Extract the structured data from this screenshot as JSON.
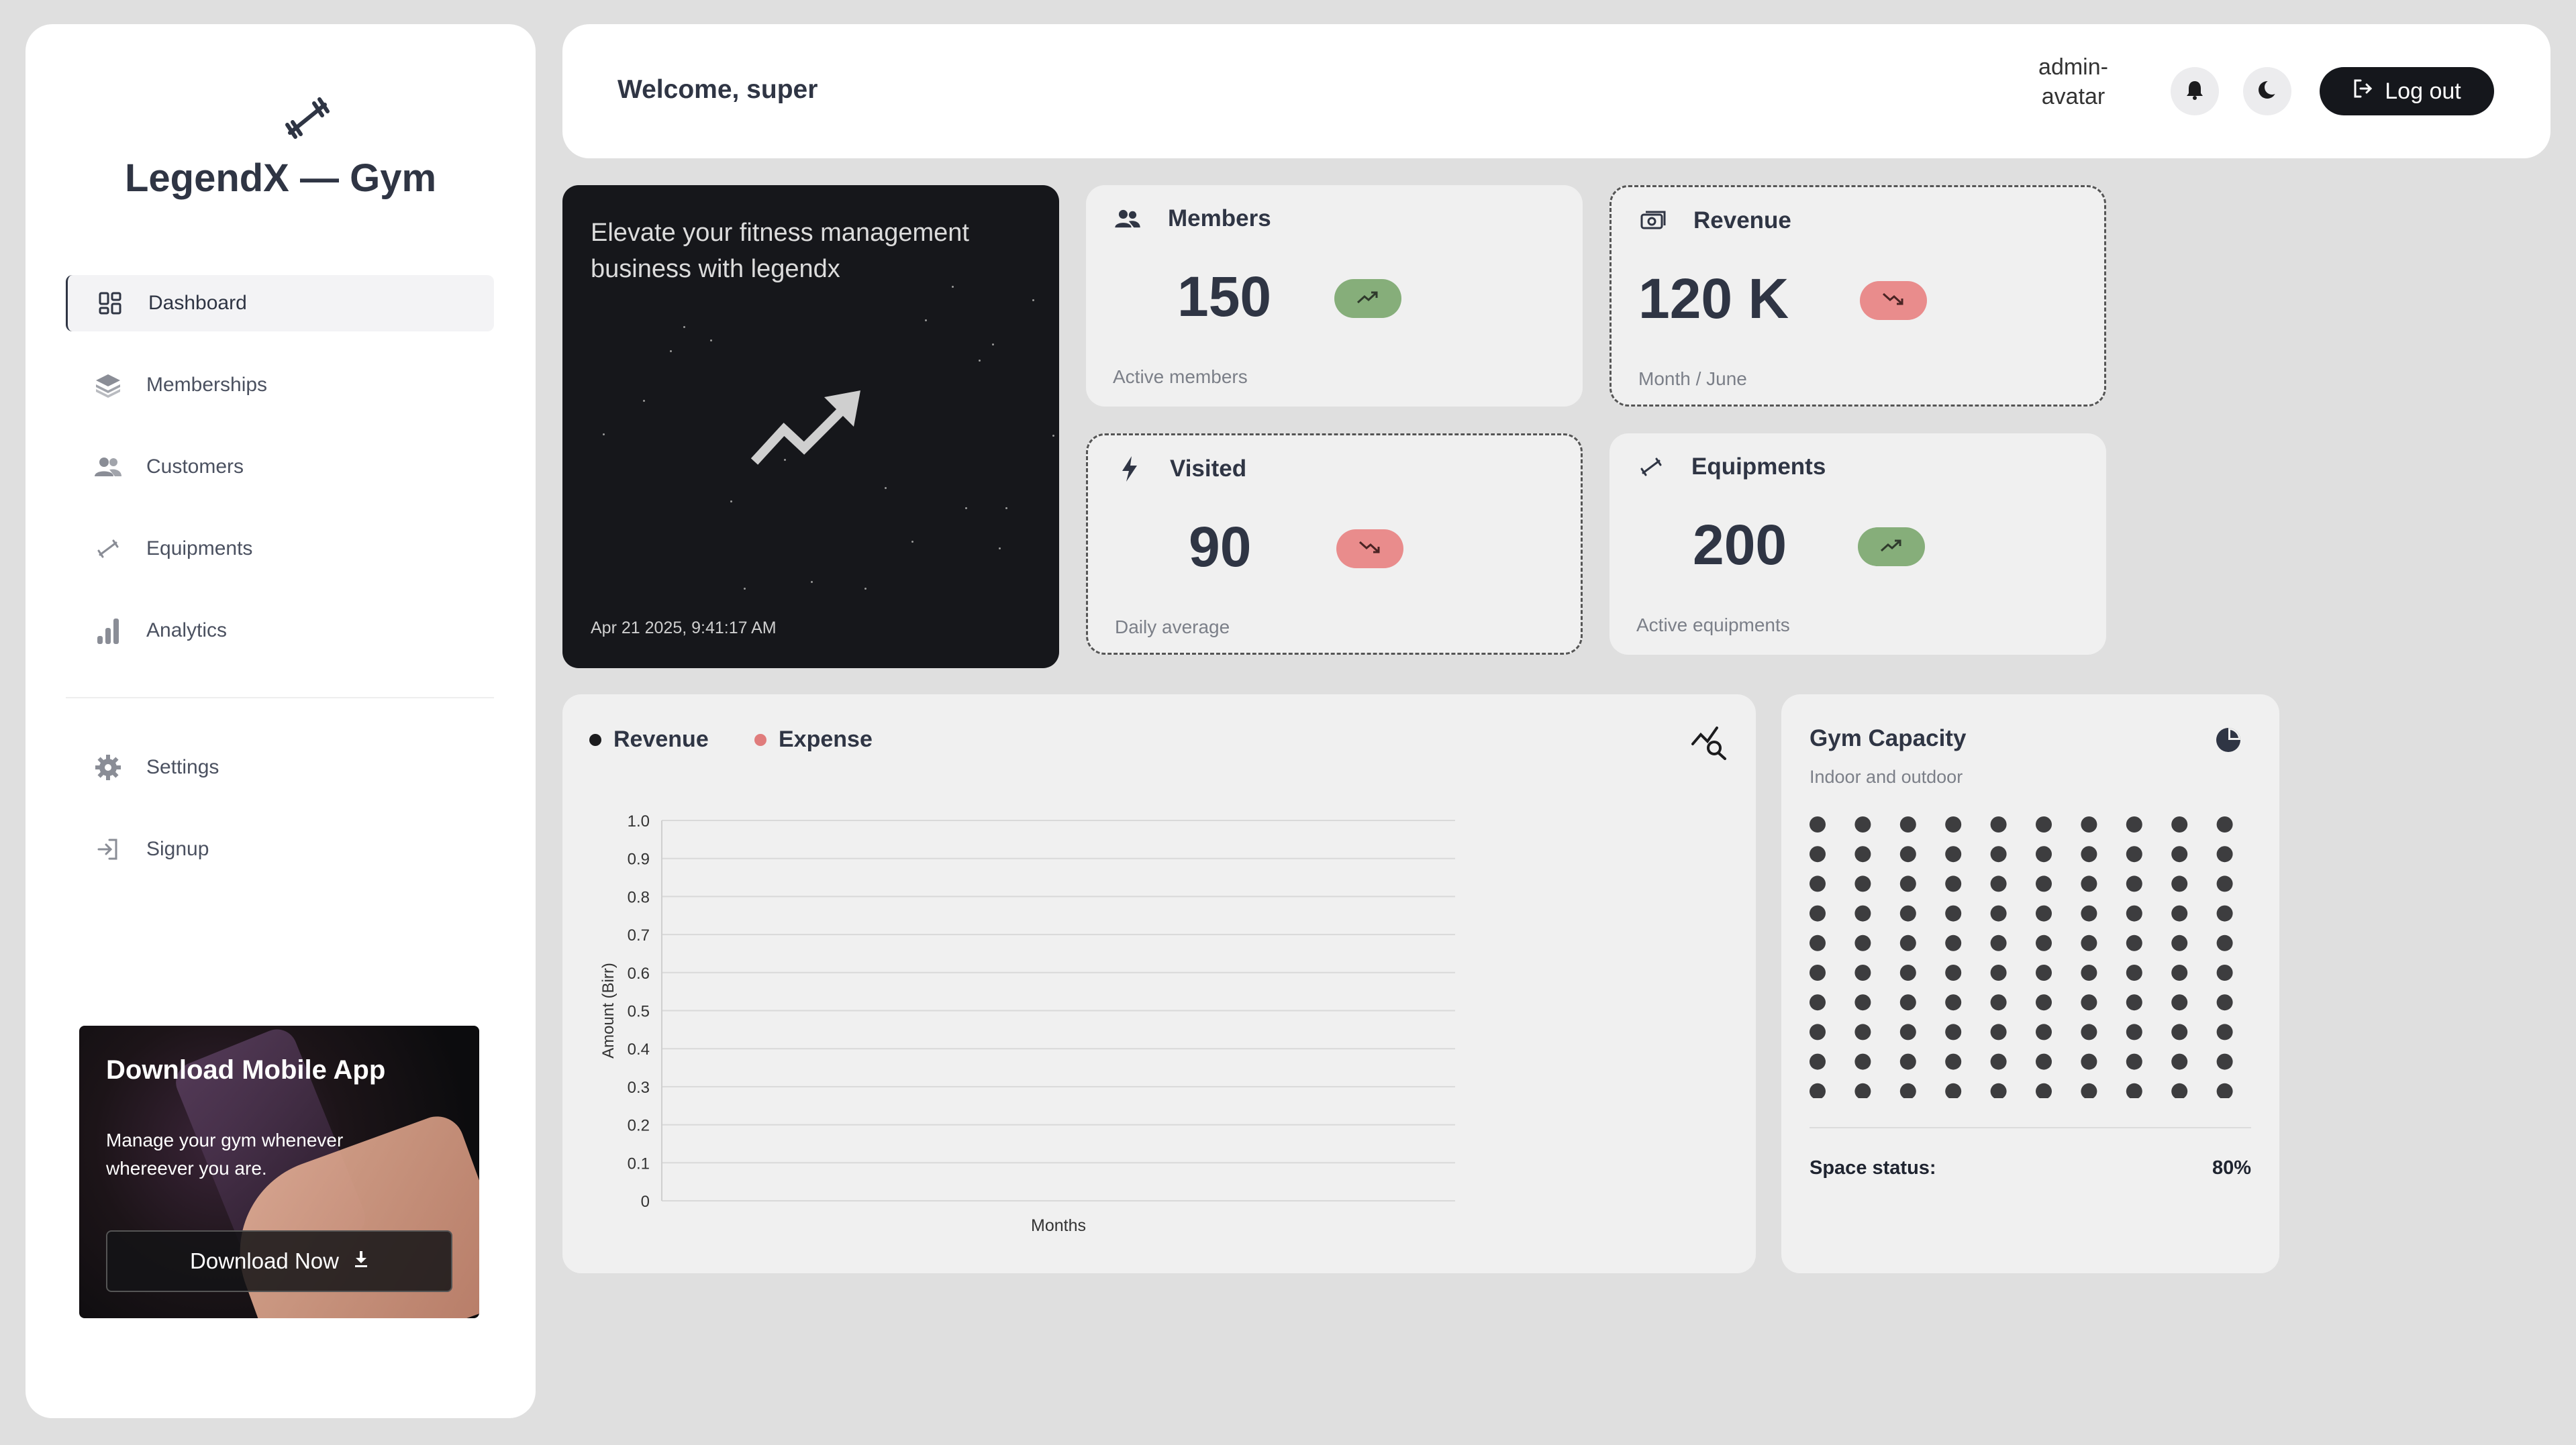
{
  "brand": {
    "name": "LegendX — Gym"
  },
  "sidebar": {
    "items": [
      {
        "label": "Dashboard",
        "icon": "dashboard-icon",
        "active": true
      },
      {
        "label": "Memberships",
        "icon": "layers-icon"
      },
      {
        "label": "Customers",
        "icon": "users-icon"
      },
      {
        "label": "Equipments",
        "icon": "dumbbell-icon"
      },
      {
        "label": "Analytics",
        "icon": "bar-chart-icon"
      }
    ],
    "bottom_items": [
      {
        "label": "Settings",
        "icon": "gear-icon"
      },
      {
        "label": "Signup",
        "icon": "sign-in-icon"
      }
    ]
  },
  "app_promo": {
    "title": "Download Mobile App",
    "description": "Manage your gym whenever whereever you are.",
    "button": "Download Now"
  },
  "header": {
    "welcome": "Welcome, super",
    "avatar_alt": "admin-avatar",
    "logout": "Log out"
  },
  "hero": {
    "text": "Elevate your fitness management business with legendx",
    "date": "Apr 21 2025, 9:41:17 AM"
  },
  "stats": {
    "members": {
      "title": "Members",
      "value": "150",
      "subtitle": "Active members",
      "trend": "up"
    },
    "revenue": {
      "title": "Revenue",
      "value": "120 K",
      "subtitle": "Month / June",
      "trend": "down"
    },
    "visited": {
      "title": "Visited",
      "value": "90",
      "subtitle": "Daily average",
      "trend": "down"
    },
    "equipments": {
      "title": "Equipments",
      "value": "200",
      "subtitle": "Active equipments",
      "trend": "up"
    }
  },
  "colors": {
    "trend_up": "#86ae7a",
    "trend_down": "#e98c8c",
    "revenue_series": "#1c1c1e",
    "expense_series": "#e07c7c",
    "dark": "#15171c"
  },
  "chart_data": {
    "type": "line",
    "series": [
      {
        "name": "Revenue",
        "values": []
      },
      {
        "name": "Expense",
        "values": []
      }
    ],
    "categories": [],
    "xlabel": "Months",
    "ylabel": "Amount (Birr)",
    "ylim": [
      0,
      1
    ],
    "yticks": [
      "0",
      "0.1",
      "0.2",
      "0.3",
      "0.4",
      "0.5",
      "0.6",
      "0.7",
      "0.8",
      "0.9",
      "1.0"
    ],
    "grid": true,
    "legend_position": "top-left"
  },
  "capacity": {
    "title": "Gym Capacity",
    "subtitle": "Indoor and outdoor",
    "status_label": "Space status:",
    "status_value": "80%",
    "rows": 10,
    "cols": 10
  }
}
